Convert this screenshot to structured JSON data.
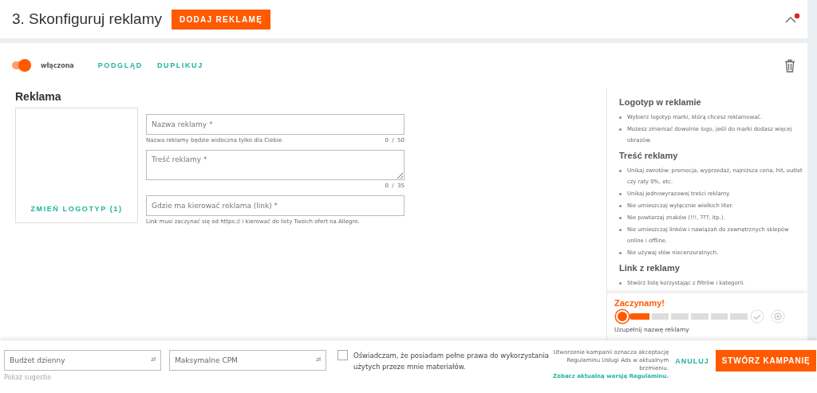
{
  "header": {
    "title": "3. Skonfiguruj reklamy",
    "add_button": "DODAJ REKLAMĘ",
    "notification": true
  },
  "ad": {
    "toggle": {
      "label": "włączona",
      "on": true
    },
    "actions": [
      "PODGLĄD",
      "DUPLIKUJ"
    ],
    "section_title": "Reklama",
    "logo_button": "ZMIEŃ LOGOTYP (1)",
    "fields": [
      {
        "kind": "input",
        "placeholder": "Nazwa reklamy *",
        "hint": "Nazwa reklamy będzie widoczna tylko dla Ciebie.",
        "counter": "0  /  50"
      },
      {
        "kind": "textarea",
        "placeholder": "Treść reklamy *",
        "counter": "0  /  35"
      },
      {
        "kind": "input",
        "placeholder": "Gdzie ma kierować reklama (link) *",
        "hint": "Link musi zaczynać się od https:// i kierować do listy Twoich ofert na Allegro."
      }
    ]
  },
  "help": [
    {
      "title": "Logotyp w reklamie",
      "items": [
        "Wybierz logotyp marki, którą chcesz reklamować.",
        "Możesz zmieniać dowolnie logo, jeśli do marki dodasz więcej obrazów."
      ]
    },
    {
      "title": "Treść reklamy",
      "items": [
        "Unikaj zwrotów: promocja, wyprzedaż, najniższa cena, hit, outlet czy raty 0%, etc.",
        "Unikaj jednowyrazowej treści reklamy.",
        "Nie umieszczaj wyłącznie wielkich liter.",
        "Nie powtarzaj znaków (!!!, ???, itp.).",
        "Nie umieszczaj linków i nawiązań do zewnętrznych sklepów online i offline.",
        "Nie używaj słów niecenzuralnych."
      ]
    },
    {
      "title": "Link z reklamy",
      "items": [
        "Stwórz listę korzystając z filtrów i kategorii."
      ]
    }
  ],
  "progress": {
    "title": "Zaczynamy!",
    "level": 0.17,
    "caption": "Uzupełnij nazwę reklamy"
  },
  "footer": {
    "budget": {
      "placeholder": "Budżet dzienny",
      "unit": "zł"
    },
    "cpm": {
      "placeholder": "Maksymalne CPM",
      "unit": "zł"
    },
    "suggest": "Pokaż sugestie",
    "consent": {
      "checked": false,
      "text": "Oświadczam, że posiadam pełne prawa do wykorzystania użytych przeze mnie materiałów."
    },
    "legal": "Utworzenie kampanii oznacza akceptację Regulaminu Usługi Ads w aktualnym brzmieniu.",
    "legal_link": "Zobacz aktualną wersję Regulaminu.",
    "cancel": "ANULUJ",
    "create": "STWÓRZ KAMPANIĘ"
  }
}
